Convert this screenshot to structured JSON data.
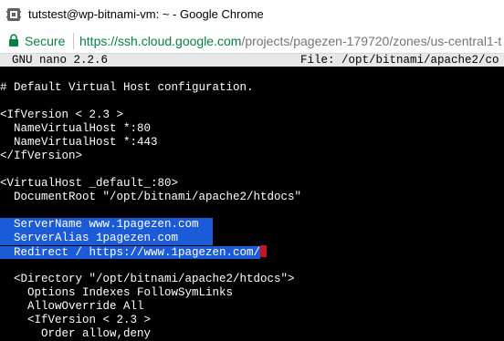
{
  "window": {
    "title": "tutstest@wp-bitnami-vm: ~ - Google Chrome"
  },
  "address_bar": {
    "secure_label": "Secure",
    "url_base": "https://ssh.cloud.google.com",
    "url_path": "/projects/pagezen-179720/zones/us-central1-t"
  },
  "nano": {
    "version": "GNU nano 2.2.6",
    "file_label": "File: /opt/bitnami/apache2/co"
  },
  "editor_lines": [
    "# Default Virtual Host configuration.",
    "<IfVersion < 2.3 >",
    "  NameVirtualHost *:80",
    "  NameVirtualHost *:443",
    "</IfVersion>",
    "<VirtualHost _default_:80>",
    "  DocumentRoot \"/opt/bitnami/apache2/htdocs\"",
    "  ServerName www.1pagezen.com",
    "  ServerAlias 1pagezen.com",
    "  Redirect / https://www.1pagezen.com/",
    "  <Directory \"/opt/bitnami/apache2/htdocs\">",
    "    Options Indexes FollowSymLinks",
    "    AllowOverride All",
    "    <IfVersion < 2.3 >",
    "      Order allow,deny"
  ],
  "colors": {
    "selection": "#1c5bd8",
    "cursor": "#c4161c",
    "secure_green": "#0b8043"
  }
}
